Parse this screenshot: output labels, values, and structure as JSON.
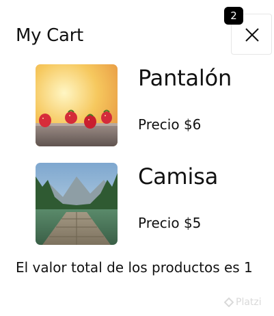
{
  "cart": {
    "title": "My Cart",
    "badge_count": "2",
    "close_label": "Close",
    "items": [
      {
        "name": "Pantalón",
        "price": "Precio $6",
        "image": "strawberries-photo"
      },
      {
        "name": "Camisa",
        "price": "Precio $5",
        "image": "lake-pier-photo"
      }
    ],
    "total_text": "El valor total de los productos es 1"
  },
  "watermark": {
    "text": "Platzi",
    "icon": "platzi-logo-icon"
  },
  "colors": {
    "badge_bg": "#000000",
    "badge_text": "#ffffff",
    "border": "#e6e6e6"
  }
}
